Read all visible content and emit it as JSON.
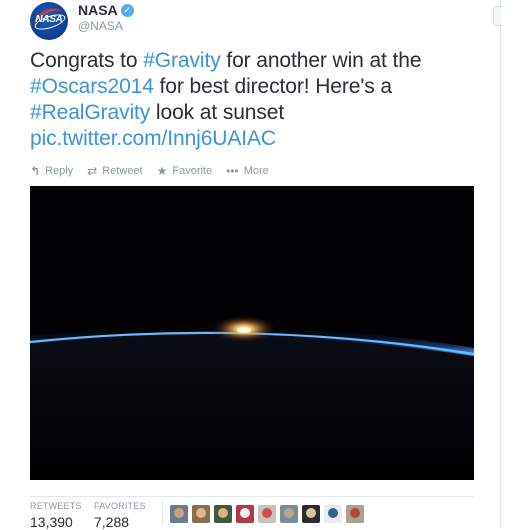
{
  "author": {
    "display_name": "NASA",
    "handle": "@NASA",
    "avatar_icon": "nasa-meatball-logo",
    "avatar_text": "NASA",
    "verified_icon": "verified-badge-icon"
  },
  "tweet": {
    "segments": [
      {
        "text": "Congrats to ",
        "kind": "text"
      },
      {
        "text": "#Gravity",
        "kind": "hashtag"
      },
      {
        "text": " for another win at the ",
        "kind": "text"
      },
      {
        "text": "#Oscars2014",
        "kind": "hashtag"
      },
      {
        "text": " for best director! Here's a ",
        "kind": "text"
      },
      {
        "text": "#RealGravity",
        "kind": "hashtag"
      },
      {
        "text": " look at sunset ",
        "kind": "text"
      },
      {
        "text": "pic.twitter.com/Innj6UAIAC",
        "kind": "link"
      }
    ]
  },
  "actions": [
    {
      "label": "Reply",
      "icon": "reply-icon"
    },
    {
      "label": "Retweet",
      "icon": "retweet-icon"
    },
    {
      "label": "Favorite",
      "icon": "star-icon"
    },
    {
      "label": "More",
      "icon": "more-dots-icon"
    }
  ],
  "stats": {
    "retweets_label": "RETWEETS",
    "retweets_value": "13,390",
    "favorites_label": "FAVORITES",
    "favorites_value": "7,288"
  },
  "favoriters": [
    {
      "bg": "#6b7a8c",
      "face": "#c9a27e"
    },
    {
      "bg": "#8a6d4f",
      "face": "#e2b48c"
    },
    {
      "bg": "#3d5a3a",
      "face": "#d8b08a"
    },
    {
      "bg": "#b23a48",
      "face": "#f1f1f1"
    },
    {
      "bg": "#c7c2c0",
      "face": "#d44b4b"
    },
    {
      "bg": "#7d8a99",
      "face": "#b8a590"
    },
    {
      "bg": "#2b2b33",
      "face": "#e0c2a6"
    },
    {
      "bg": "#e8edf2",
      "face": "#3a5f8a"
    },
    {
      "bg": "#a9a191",
      "face": "#b04a36"
    }
  ],
  "colors": {
    "link": "#3b94d9",
    "text": "#292f33",
    "muted": "#8899a6",
    "verified": "#55acee",
    "horizon_blue": "#4fa8ff",
    "sun_glow": "#ffd27a"
  }
}
